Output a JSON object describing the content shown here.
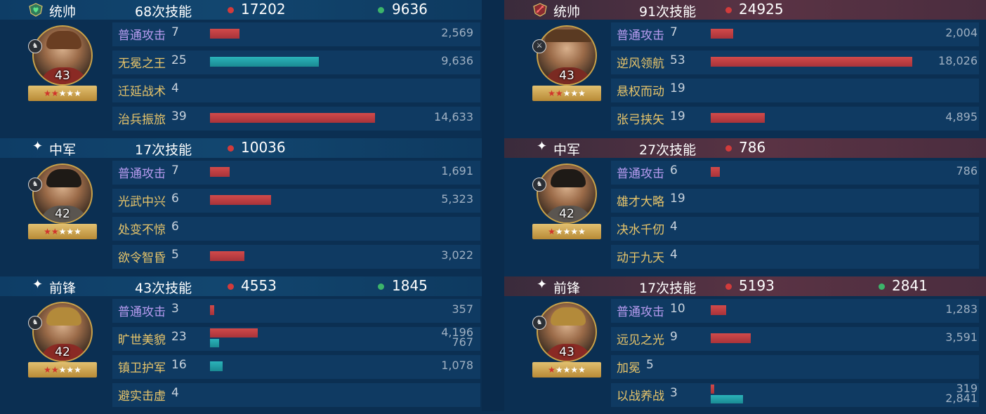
{
  "teams": [
    {
      "side": "left",
      "header_color": "#12466f",
      "generals": [
        {
          "role": "统帅",
          "role_icon": "heart-shield-icon",
          "casts": "68次技能",
          "damage": "17202",
          "heal": "9636",
          "level": "43",
          "stars": {
            "red": 2,
            "white": 3
          },
          "badge_icon": "cavalry-icon",
          "skills": [
            {
              "name": "普通攻击",
              "count": "7",
              "is_attack": true,
              "dmg": "2,569",
              "dmg_frac": 0.18
            },
            {
              "name": "无冕之王",
              "count": "25",
              "is_attack": false,
              "heal": "9,636",
              "heal_frac": 0.66
            },
            {
              "name": "迁延战术",
              "count": "4",
              "is_attack": false
            },
            {
              "name": "治兵振旅",
              "count": "39",
              "is_attack": false,
              "dmg": "14,633",
              "dmg_frac": 1.0
            }
          ]
        },
        {
          "role": "中军",
          "role_icon": "sparkle-icon",
          "casts": "17次技能",
          "damage": "10036",
          "level": "42",
          "stars": {
            "red": 2,
            "white": 3
          },
          "badge_icon": "cavalry-icon",
          "skills": [
            {
              "name": "普通攻击",
              "count": "7",
              "is_attack": true,
              "dmg": "1,691",
              "dmg_frac": 0.12
            },
            {
              "name": "光武中兴",
              "count": "6",
              "is_attack": false,
              "dmg": "5,323",
              "dmg_frac": 0.37
            },
            {
              "name": "处变不惊",
              "count": "6",
              "is_attack": false
            },
            {
              "name": "欲令智昏",
              "count": "5",
              "is_attack": false,
              "dmg": "3,022",
              "dmg_frac": 0.21
            }
          ]
        },
        {
          "role": "前锋",
          "role_icon": "sparkle-icon",
          "casts": "43次技能",
          "damage": "4553",
          "heal": "1845",
          "level": "42",
          "stars": {
            "red": 2,
            "white": 3
          },
          "badge_icon": "cavalry-icon",
          "skills": [
            {
              "name": "普通攻击",
              "count": "3",
              "is_attack": true,
              "dmg": "357",
              "dmg_frac": 0.025
            },
            {
              "name": "旷世美貌",
              "count": "23",
              "is_attack": false,
              "dmg": "4,196",
              "dmg_frac": 0.29,
              "heal": "767",
              "heal_frac": 0.055
            },
            {
              "name": "镇卫护军",
              "count": "16",
              "is_attack": false,
              "heal": "1,078",
              "heal_frac": 0.075
            },
            {
              "name": "避实击虚",
              "count": "4",
              "is_attack": false
            }
          ]
        }
      ]
    },
    {
      "side": "right",
      "header_color": "#5a3344",
      "generals": [
        {
          "role": "统帅",
          "role_icon": "sword-shield-icon",
          "casts": "91次技能",
          "damage": "24925",
          "level": "43",
          "stars": {
            "red": 2,
            "white": 3
          },
          "badge_icon": "spear-icon",
          "skills": [
            {
              "name": "普通攻击",
              "count": "7",
              "is_attack": true,
              "dmg": "2,004",
              "dmg_frac": 0.11
            },
            {
              "name": "逆风领航",
              "count": "53",
              "is_attack": false,
              "dmg": "18,026",
              "dmg_frac": 1.0
            },
            {
              "name": "悬权而动",
              "count": "19",
              "is_attack": false
            },
            {
              "name": "张弓挟矢",
              "count": "19",
              "is_attack": false,
              "dmg": "4,895",
              "dmg_frac": 0.27
            }
          ]
        },
        {
          "role": "中军",
          "role_icon": "sparkle-icon",
          "casts": "27次技能",
          "damage": "786",
          "level": "42",
          "stars": {
            "red": 1,
            "white": 4
          },
          "badge_icon": "cavalry-icon",
          "skills": [
            {
              "name": "普通攻击",
              "count": "6",
              "is_attack": true,
              "dmg": "786",
              "dmg_frac": 0.045
            },
            {
              "name": "雄才大略",
              "count": "19",
              "is_attack": false
            },
            {
              "name": "决水千仞",
              "count": "4",
              "is_attack": false
            },
            {
              "name": "动于九天",
              "count": "4",
              "is_attack": false
            }
          ]
        },
        {
          "role": "前锋",
          "role_icon": "sparkle-icon",
          "casts": "17次技能",
          "damage": "5193",
          "heal": "2841",
          "level": "43",
          "stars": {
            "red": 1,
            "white": 4
          },
          "badge_icon": "cavalry-icon",
          "skills": [
            {
              "name": "普通攻击",
              "count": "10",
              "is_attack": true,
              "dmg": "1,283",
              "dmg_frac": 0.075
            },
            {
              "name": "远见之光",
              "count": "9",
              "is_attack": false,
              "dmg": "3,591",
              "dmg_frac": 0.2
            },
            {
              "name": "加冕",
              "count": "5",
              "is_attack": false
            },
            {
              "name": "以战养战",
              "count": "3",
              "is_attack": false,
              "dmg": "319",
              "dmg_frac": 0.018,
              "heal": "2,841",
              "heal_frac": 0.16
            }
          ]
        }
      ]
    }
  ]
}
